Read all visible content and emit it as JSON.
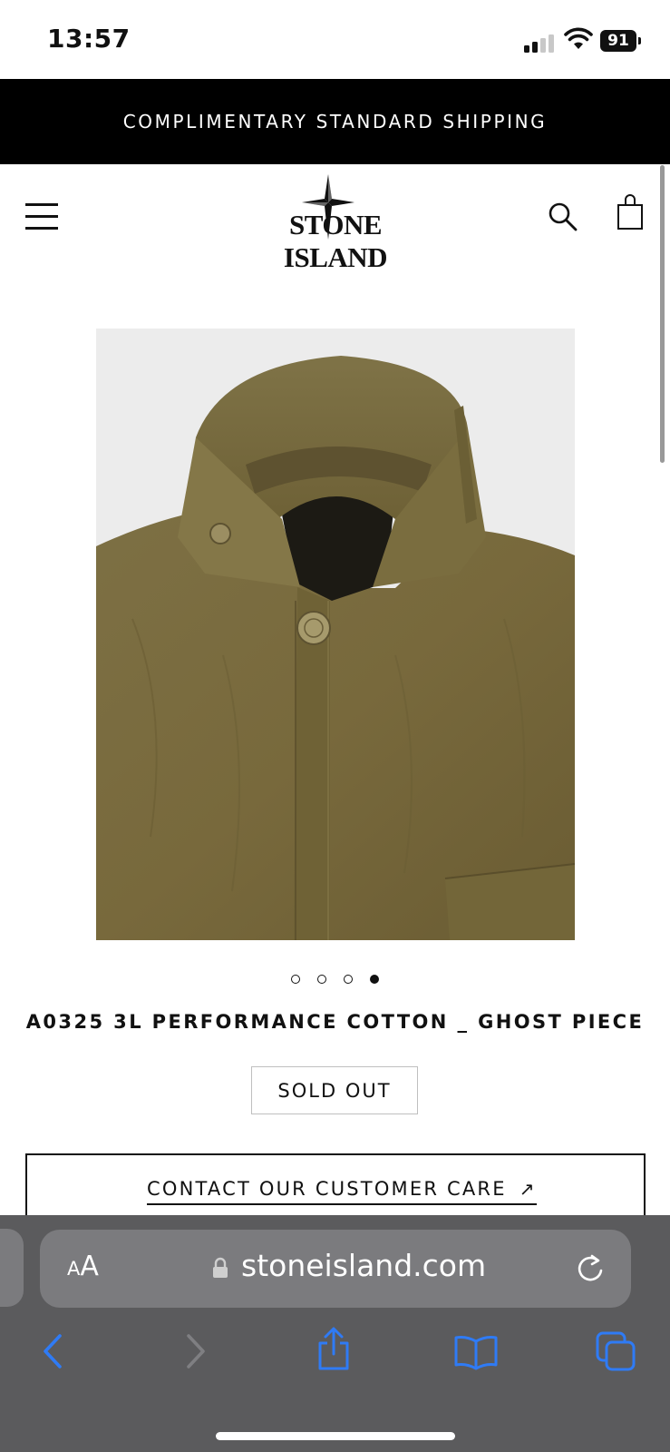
{
  "status_bar": {
    "time": "13:57",
    "battery": "91"
  },
  "promo": {
    "text": "COMPLIMENTARY STANDARD SHIPPING"
  },
  "header": {
    "logo_text": "STONE ISLAND"
  },
  "product": {
    "title": "A0325 3L PERFORMANCE COTTON _ GHOST PIECE",
    "status": "SOLD OUT",
    "image_count": 4,
    "active_image": 4,
    "image_subject": "olive green jacket collar close-up"
  },
  "contact": {
    "label": "CONTACT OUR CUSTOMER CARE",
    "arrow": "↗"
  },
  "browser": {
    "text_size_label": "AA",
    "url": "stoneisland.com",
    "icons": [
      "lock-icon",
      "reload-icon",
      "back-icon",
      "forward-icon",
      "share-icon",
      "bookmarks-icon",
      "tabs-icon"
    ]
  },
  "colors": {
    "promo_bg": "#000000",
    "safari_bar": "#5b5b5d",
    "url_bar": "#7b7b7e",
    "ios_blue": "#2f7bf5",
    "jacket": "#7a6d40"
  }
}
